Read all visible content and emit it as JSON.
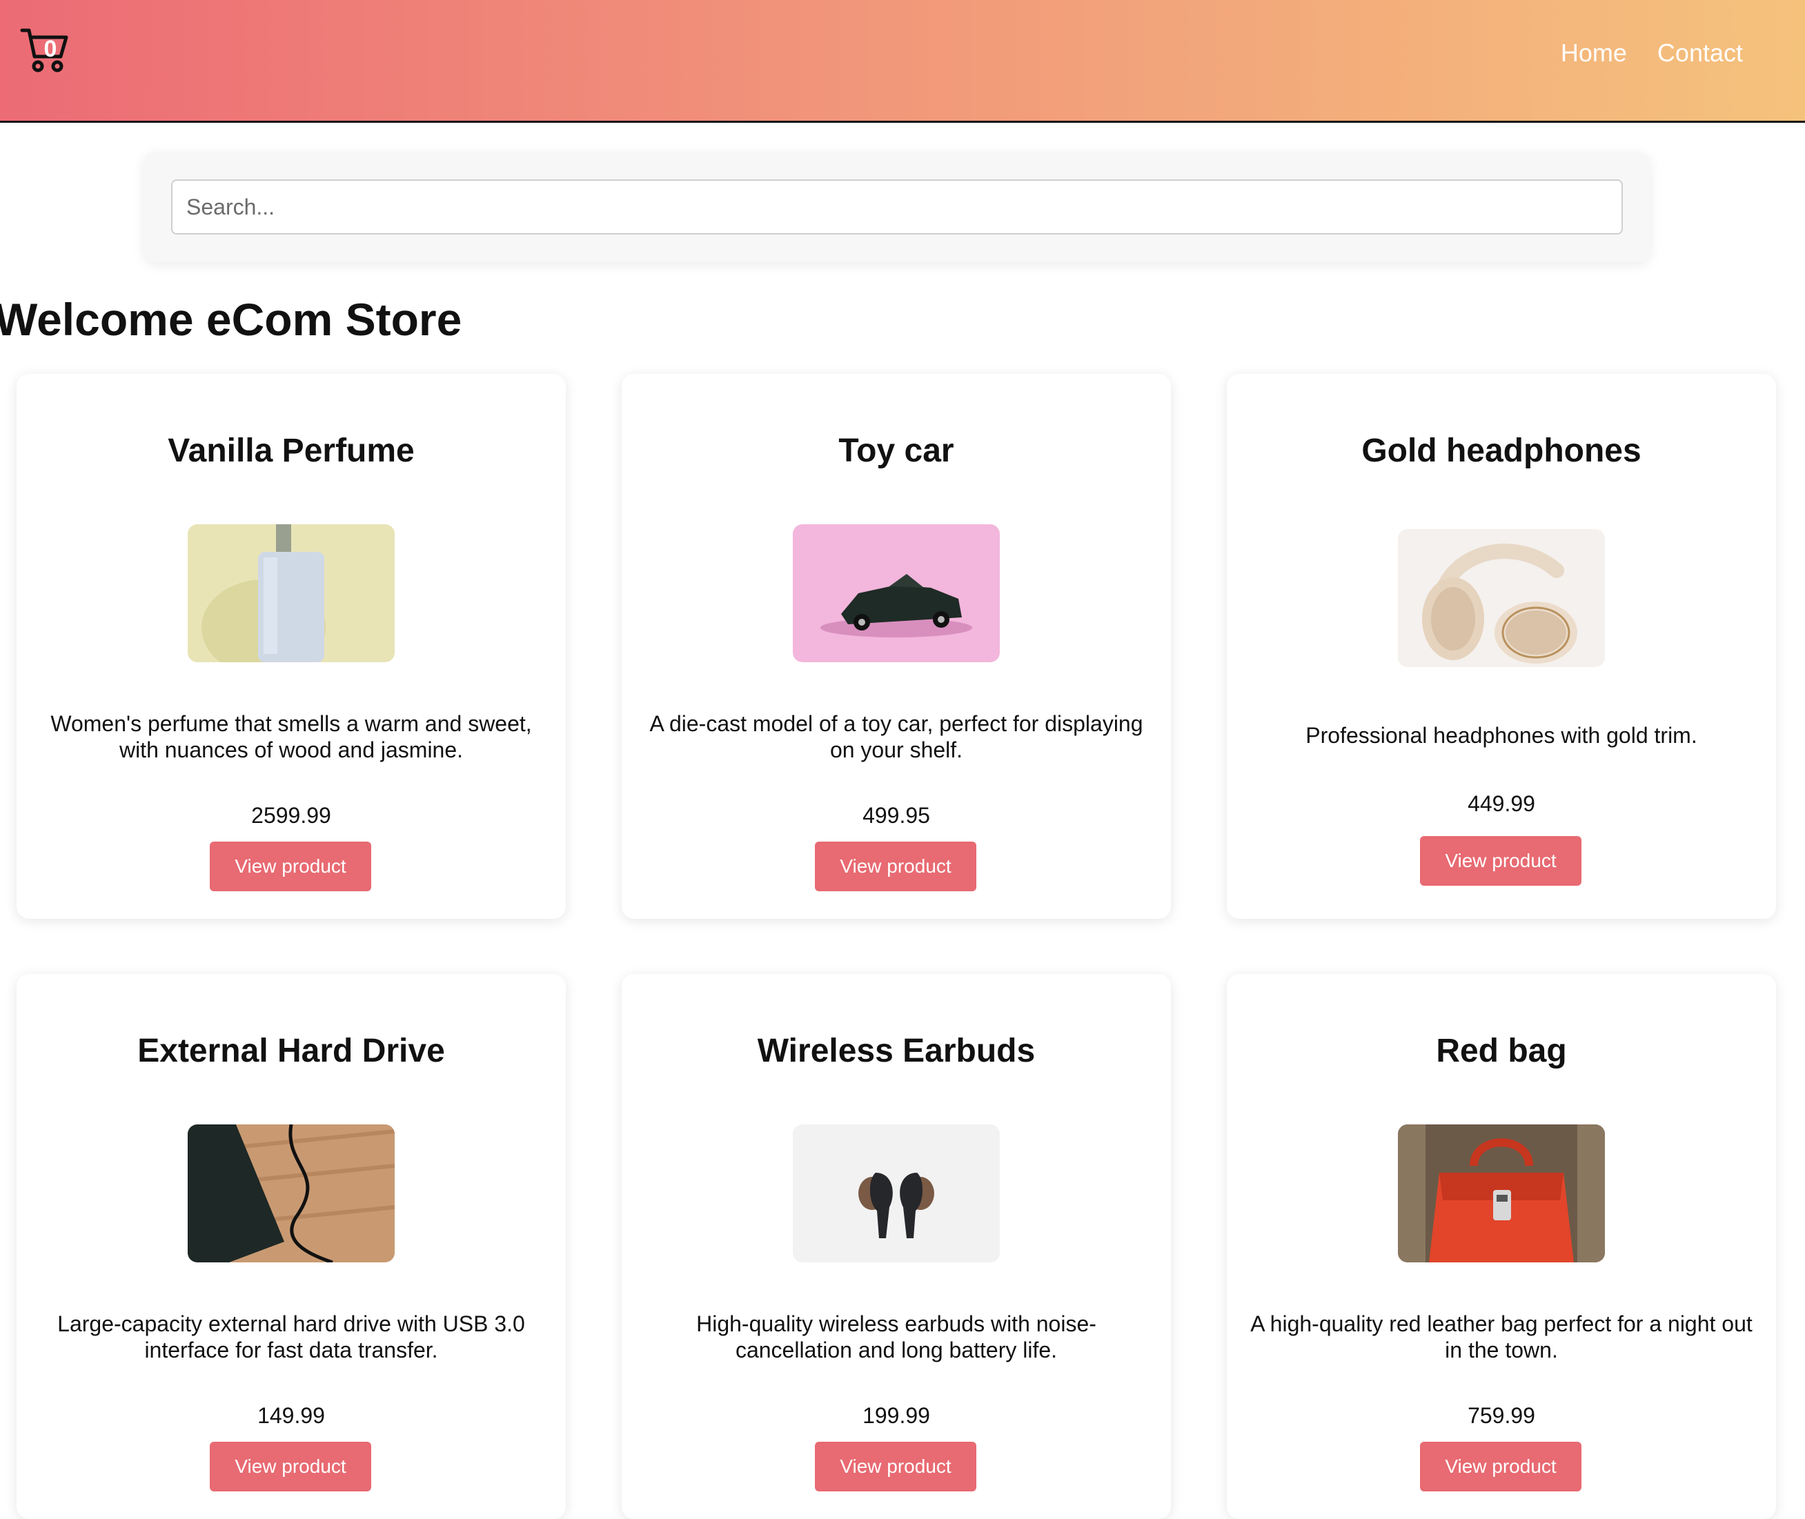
{
  "header": {
    "cart_icon": "shopping-cart-icon",
    "cart_count": "0",
    "nav": [
      {
        "label": "Home"
      },
      {
        "label": "Contact"
      }
    ],
    "gradient_colors": [
      "#ec6b75",
      "#f5c27c"
    ]
  },
  "search": {
    "placeholder": "Search...",
    "value": ""
  },
  "page_title": "Welcome eCom Store",
  "accent_color": "#e86a72",
  "products": [
    {
      "title": "Vanilla Perfume",
      "description": "Women's perfume that smells a warm and sweet, with nuances of wood and jasmine.",
      "price": "2599.99",
      "button": "View product"
    },
    {
      "title": "Toy car",
      "description": "A die-cast model of a toy car, perfect for displaying on your shelf.",
      "price": "499.95",
      "button": "View product"
    },
    {
      "title": "Gold headphones",
      "description": "Professional headphones with gold trim.",
      "price": "449.99",
      "button": "View product"
    },
    {
      "title": "External Hard Drive",
      "description": "Large-capacity external hard drive with USB 3.0 interface for fast data transfer.",
      "price": "149.99",
      "button": "View product"
    },
    {
      "title": "Wireless Earbuds",
      "description": "High-quality wireless earbuds with noise-cancellation and long battery life.",
      "price": "199.99",
      "button": "View product"
    },
    {
      "title": "Red bag",
      "description": "A high-quality red leather bag perfect for a night out in the town.",
      "price": "759.99",
      "button": "View product"
    }
  ]
}
